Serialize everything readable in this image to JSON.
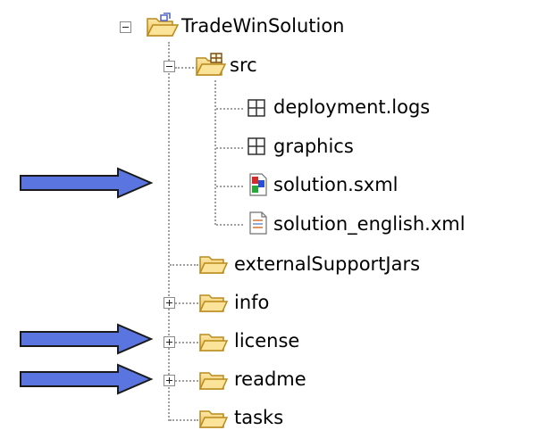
{
  "tree": {
    "root": {
      "label": "TradeWinSolution",
      "expanded": true,
      "icon": "project-folder-icon"
    },
    "src": {
      "label": "src",
      "expanded": true,
      "icon": "source-folder-icon",
      "children": [
        {
          "label": "deployment.logs",
          "icon": "package-icon"
        },
        {
          "label": "graphics",
          "icon": "package-icon"
        },
        {
          "label": "solution.sxml",
          "icon": "sxml-file-icon"
        },
        {
          "label": "solution_english.xml",
          "icon": "xml-file-icon"
        }
      ]
    },
    "folders": [
      {
        "label": "externalSupportJars",
        "expandable": false,
        "icon": "folder-icon"
      },
      {
        "label": "info",
        "expandable": true,
        "expanded": false,
        "icon": "folder-icon"
      },
      {
        "label": "license",
        "expandable": true,
        "expanded": false,
        "icon": "folder-icon"
      },
      {
        "label": "readme",
        "expandable": true,
        "expanded": false,
        "icon": "folder-icon"
      },
      {
        "label": "tasks",
        "expandable": false,
        "icon": "folder-icon"
      }
    ]
  },
  "annotations": {
    "arrow_color": "#5b75e0",
    "arrow_outline": "#1a1a1a",
    "arrows": [
      {
        "points_to": "solution.sxml"
      },
      {
        "points_to": "license"
      },
      {
        "points_to": "readme"
      }
    ]
  }
}
